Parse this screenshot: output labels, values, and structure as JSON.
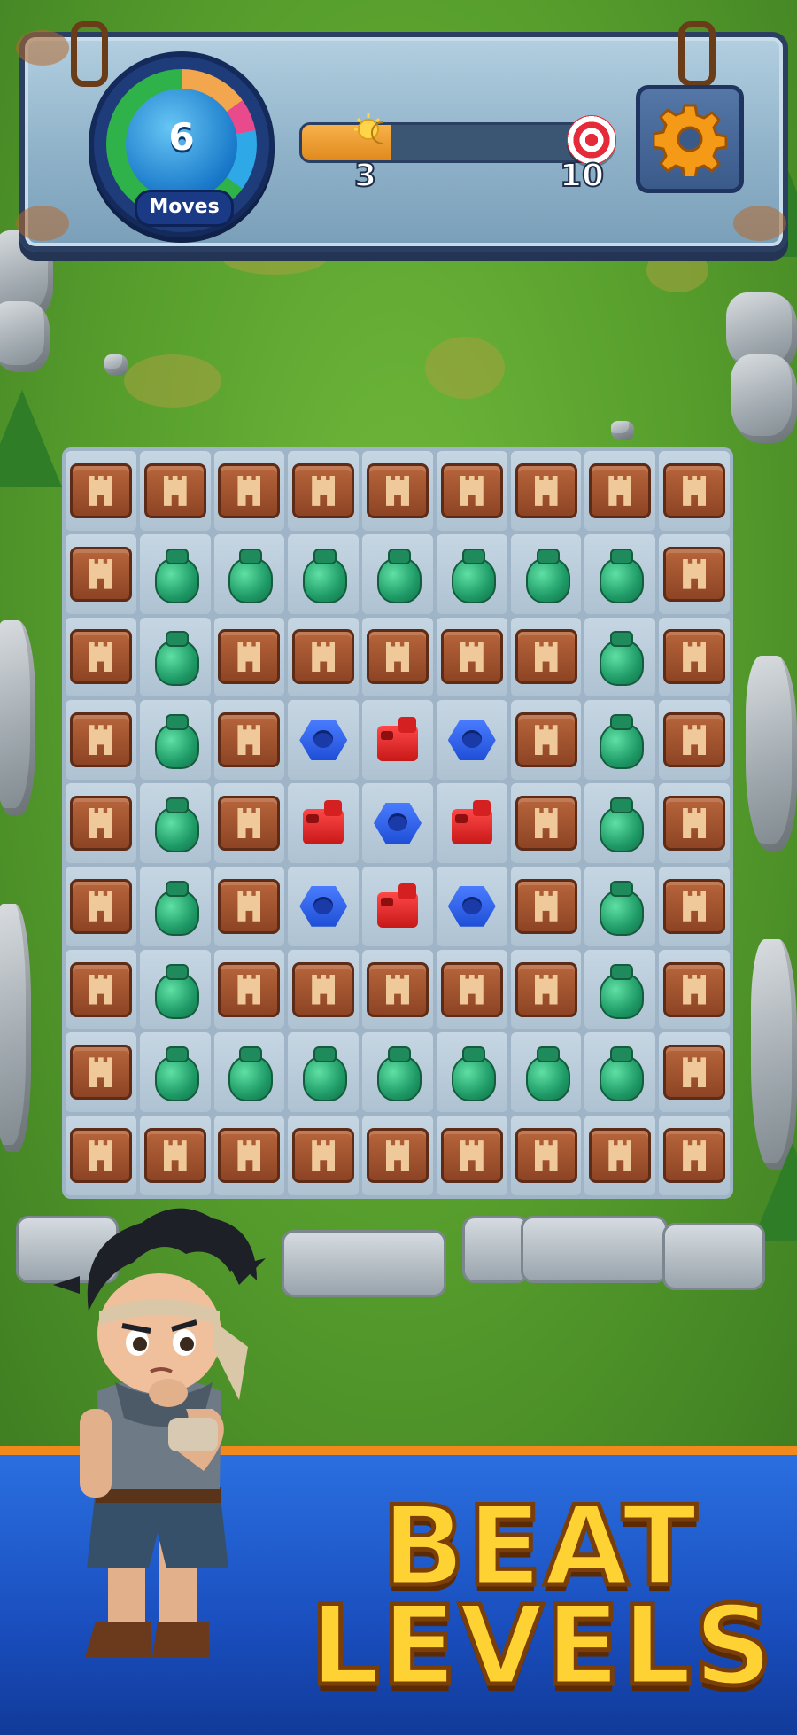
{
  "hud": {
    "moves_label": "Moves",
    "moves_remaining": "6",
    "progress_value": "3",
    "target_value": "10",
    "progress_fraction": 0.3
  },
  "icons": {
    "settings": "gear-icon",
    "progress": "sun-moon-icon",
    "target": "target-icon"
  },
  "board": {
    "rows": 9,
    "cols": 9,
    "grid": [
      [
        "crate",
        "crate",
        "crate",
        "crate",
        "crate",
        "crate",
        "crate",
        "crate",
        "crate"
      ],
      [
        "crate",
        "vase",
        "vase",
        "vase",
        "vase",
        "vase",
        "vase",
        "vase",
        "crate"
      ],
      [
        "crate",
        "vase",
        "crate",
        "crate",
        "crate",
        "crate",
        "crate",
        "vase",
        "crate"
      ],
      [
        "crate",
        "vase",
        "crate",
        "nut",
        "jerrycan",
        "nut",
        "crate",
        "vase",
        "crate"
      ],
      [
        "crate",
        "vase",
        "crate",
        "jerrycan",
        "nut",
        "jerrycan",
        "crate",
        "vase",
        "crate"
      ],
      [
        "crate",
        "vase",
        "crate",
        "nut",
        "jerrycan",
        "nut",
        "crate",
        "vase",
        "crate"
      ],
      [
        "crate",
        "vase",
        "crate",
        "crate",
        "crate",
        "crate",
        "crate",
        "vase",
        "crate"
      ],
      [
        "crate",
        "vase",
        "vase",
        "vase",
        "vase",
        "vase",
        "vase",
        "vase",
        "crate"
      ],
      [
        "crate",
        "crate",
        "crate",
        "crate",
        "crate",
        "crate",
        "crate",
        "crate",
        "crate"
      ]
    ]
  },
  "banner": {
    "line1": "BEAT",
    "line2": "LEVELS"
  },
  "colors": {
    "banner_blue": "#1a4fbf",
    "banner_text": "#ffd233",
    "accent_orange": "#f08a1c"
  }
}
